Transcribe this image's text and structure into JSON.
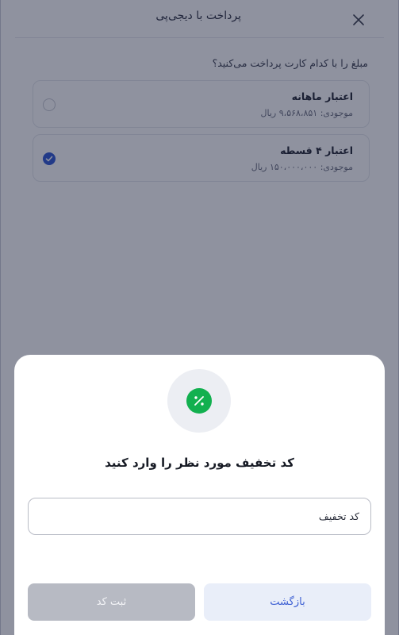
{
  "header": {
    "title": "پرداخت با دیجی‌پی"
  },
  "question": "مبلغ را با کدام کارت پرداخت می‌کنید؟",
  "cards": [
    {
      "title": "اعتبار ماهانه",
      "balance": "موجودی: ۹،۵۶۸،۸۵۱ ریال",
      "selected": false
    },
    {
      "title": "اعتبار ۴ قسطه",
      "balance": "موجودی: ۱۵۰،۰۰۰،۰۰۰ ریال",
      "selected": true
    }
  ],
  "sheet": {
    "icon": "percent-icon",
    "title": "کد تخفیف مورد نظر را وارد کنید",
    "input_placeholder": "کد تخفیف",
    "input_value": "",
    "back_label": "بازگشت",
    "submit_label": "ثبت کد"
  },
  "colors": {
    "accent": "#2f57d3",
    "success": "#12b04f",
    "overlay": "rgba(20,28,55,0.48)"
  }
}
